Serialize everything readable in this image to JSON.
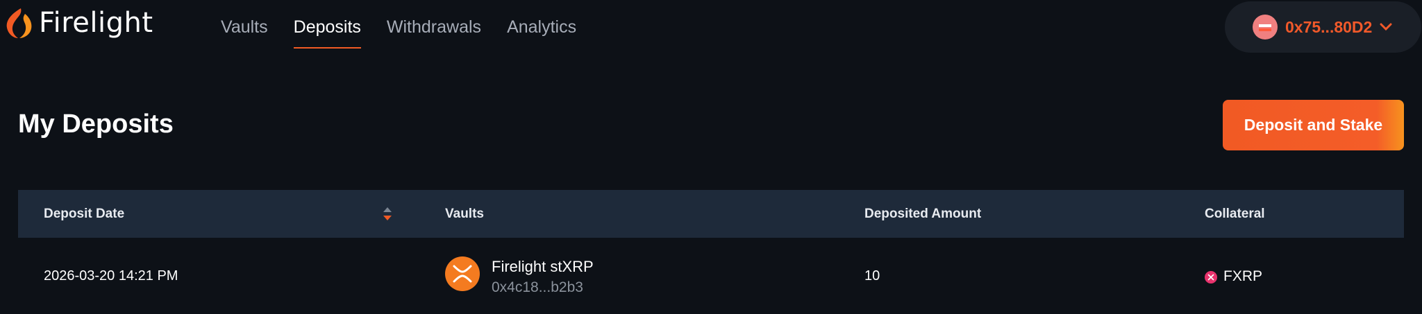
{
  "app": {
    "brand": "Firelight",
    "colors": {
      "accent": "#f15a24",
      "background": "#0d1117",
      "table_header": "#1e2a3a"
    }
  },
  "nav": {
    "items": [
      {
        "label": "Vaults",
        "active": false
      },
      {
        "label": "Deposits",
        "active": true
      },
      {
        "label": "Withdrawals",
        "active": false
      },
      {
        "label": "Analytics",
        "active": false
      }
    ]
  },
  "wallet": {
    "address": "0x75...80D2",
    "icon": "wallet-avatar-icon"
  },
  "page": {
    "title": "My Deposits",
    "primary_action": "Deposit and Stake"
  },
  "table": {
    "columns": [
      "Deposit Date",
      "Vaults",
      "Deposited Amount",
      "Collateral"
    ],
    "rows": [
      {
        "deposit_date": "2026-03-20 14:21 PM",
        "vault_name": "Firelight stXRP",
        "vault_address": "0x4c18...b2b3",
        "deposited_amount": "10",
        "collateral": "FXRP"
      }
    ]
  }
}
